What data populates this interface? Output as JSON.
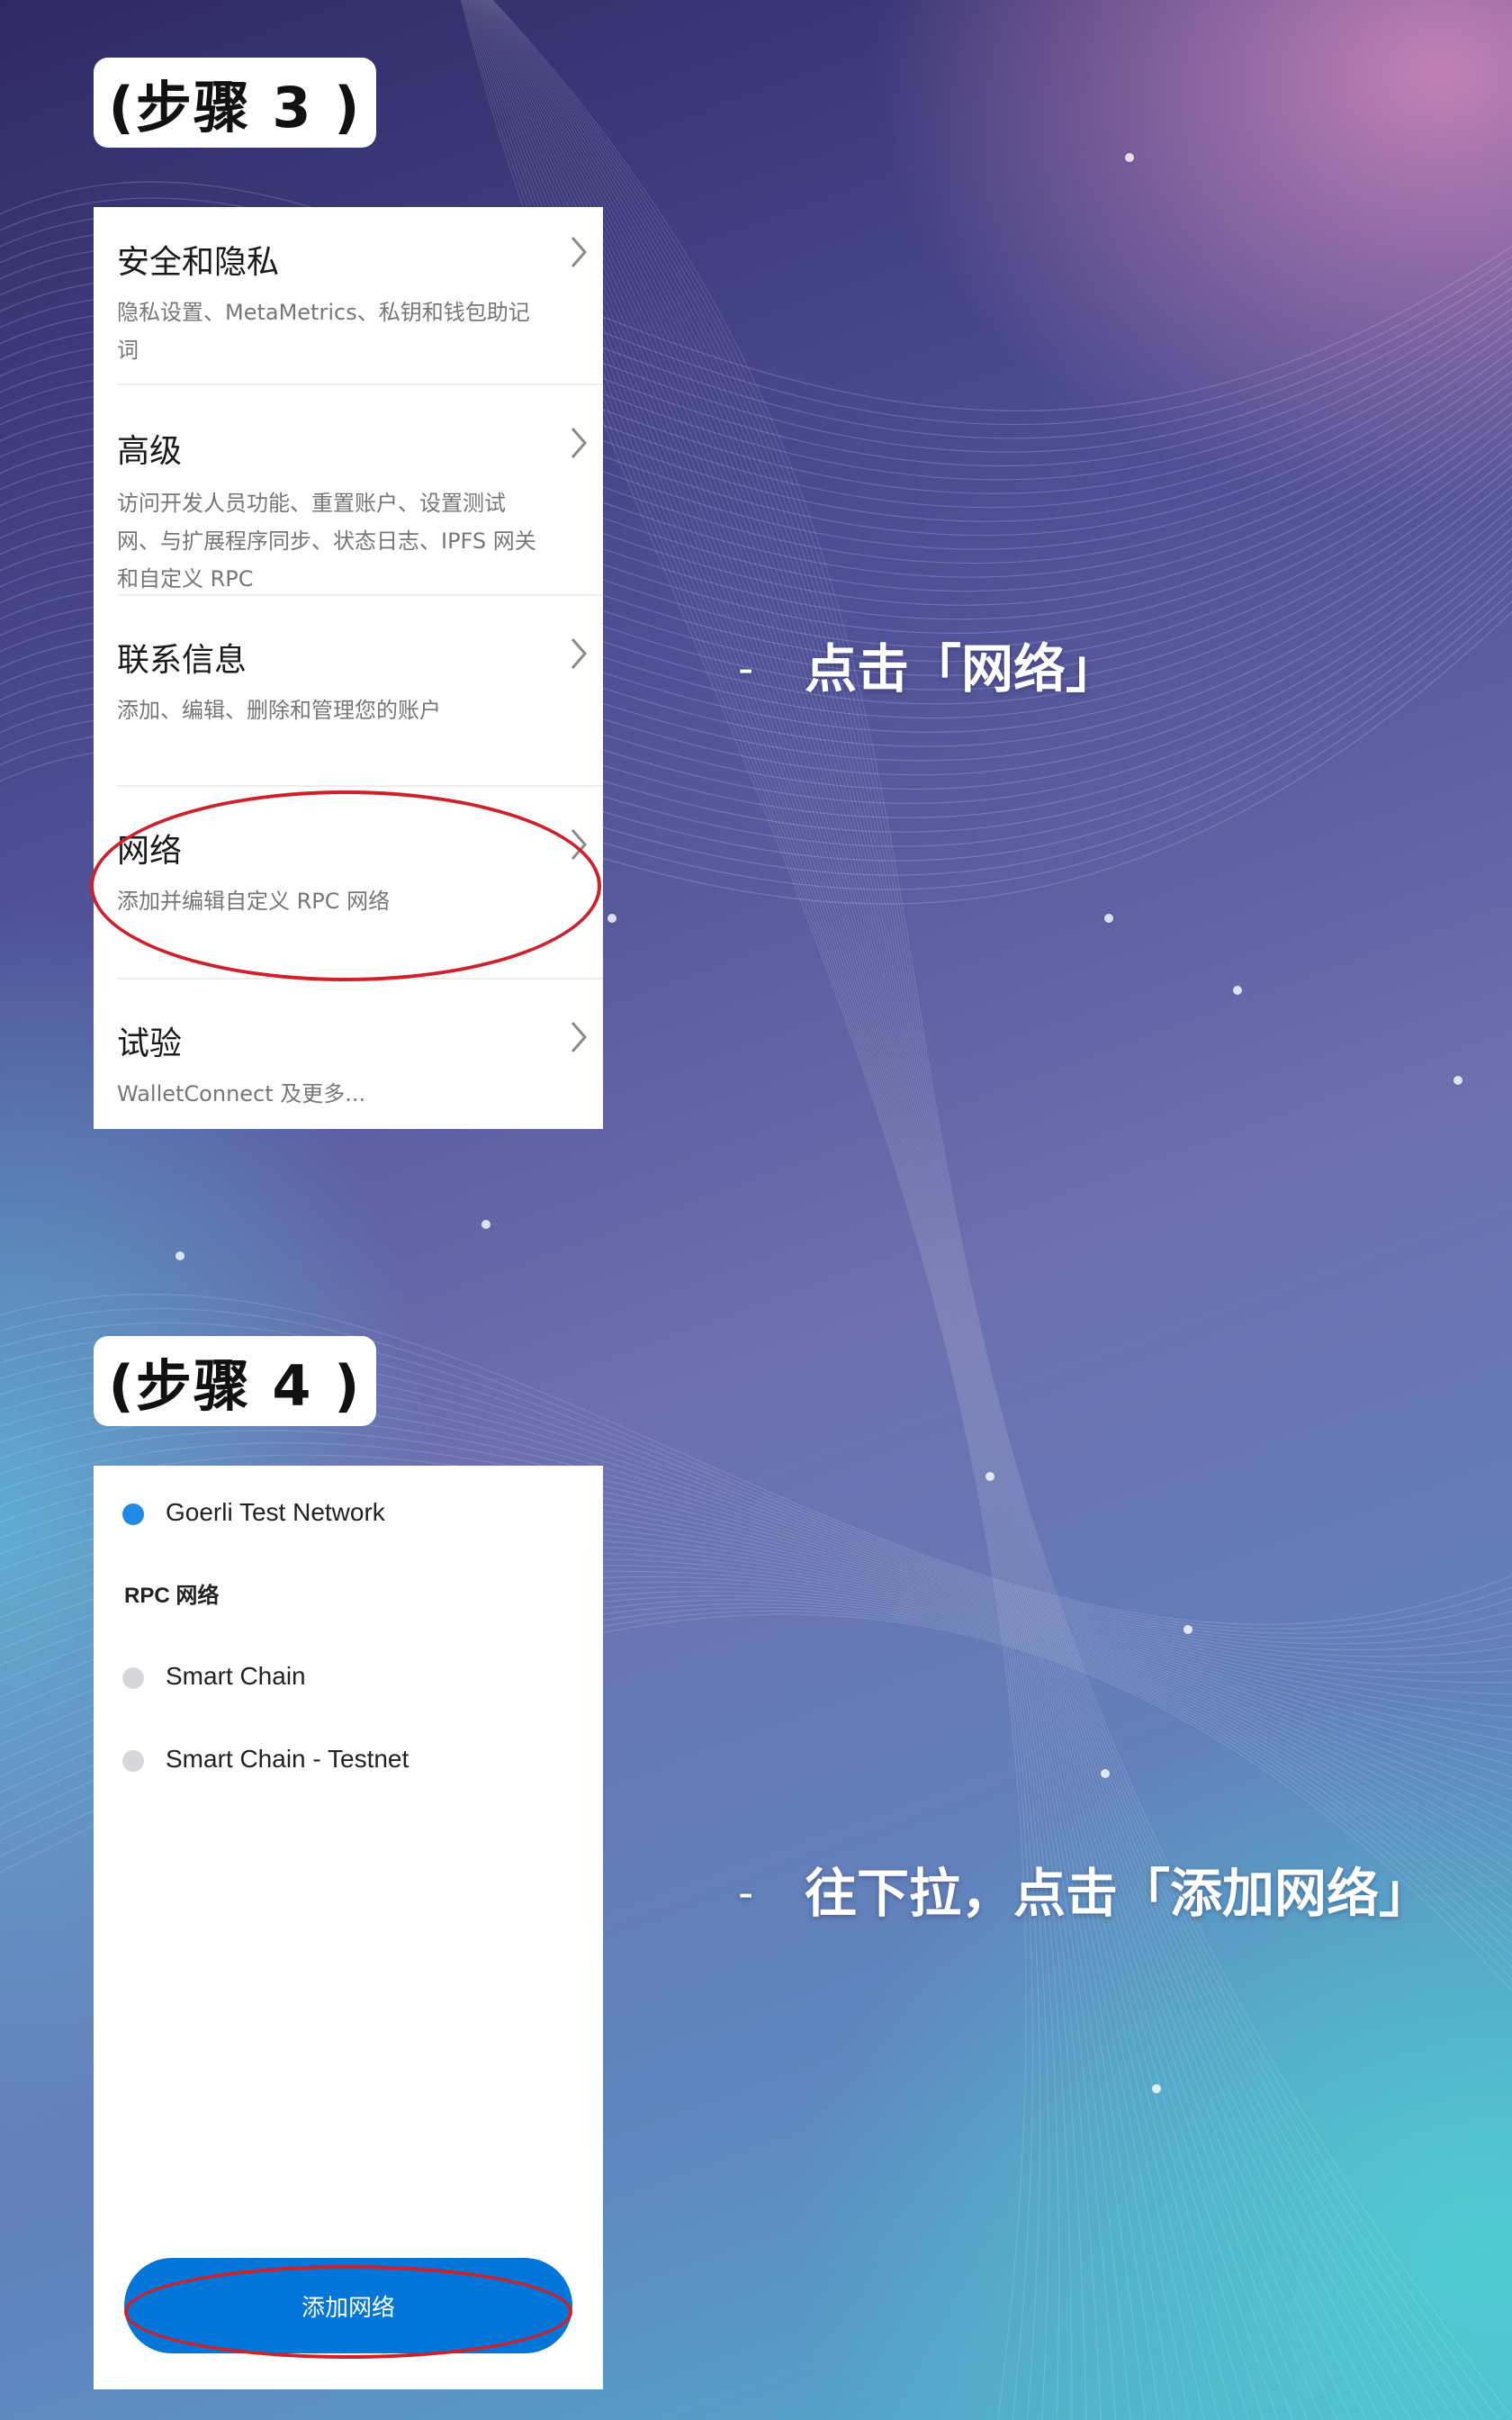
{
  "colors": {
    "accent_blue": "#0376d9",
    "selected_dot": "#1e8ae6",
    "unselected_dot": "#d5d7db",
    "highlight_red": "#d0202a"
  },
  "step3": {
    "label": "(步骤 3 )",
    "items": [
      {
        "title": "安全和隐私",
        "desc": "隐私设置、MetaMetrics、私钥和钱包助记词"
      },
      {
        "title": "高级",
        "desc": "访问开发人员功能、重置账户、设置测试网、与扩展程序同步、状态日志、IPFS 网关和自定义 RPC"
      },
      {
        "title": "联系信息",
        "desc": "添加、编辑、删除和管理您的账户"
      },
      {
        "title": "网络",
        "desc": "添加并编辑自定义 RPC 网络"
      },
      {
        "title": "试验",
        "desc": "WalletConnect 及更多..."
      }
    ],
    "instruction": "点击「网络」"
  },
  "step4": {
    "label": "(步骤 4 )",
    "selected_network": "Goerli Test Network",
    "rpc_heading": "RPC 网络",
    "rpc_networks": [
      "Smart Chain",
      "Smart Chain - Testnet"
    ],
    "add_button": "添加网络",
    "instruction": "往下拉，点击「添加网络」"
  },
  "dash": "-",
  "chevron_icon": "chevron-right-icon"
}
